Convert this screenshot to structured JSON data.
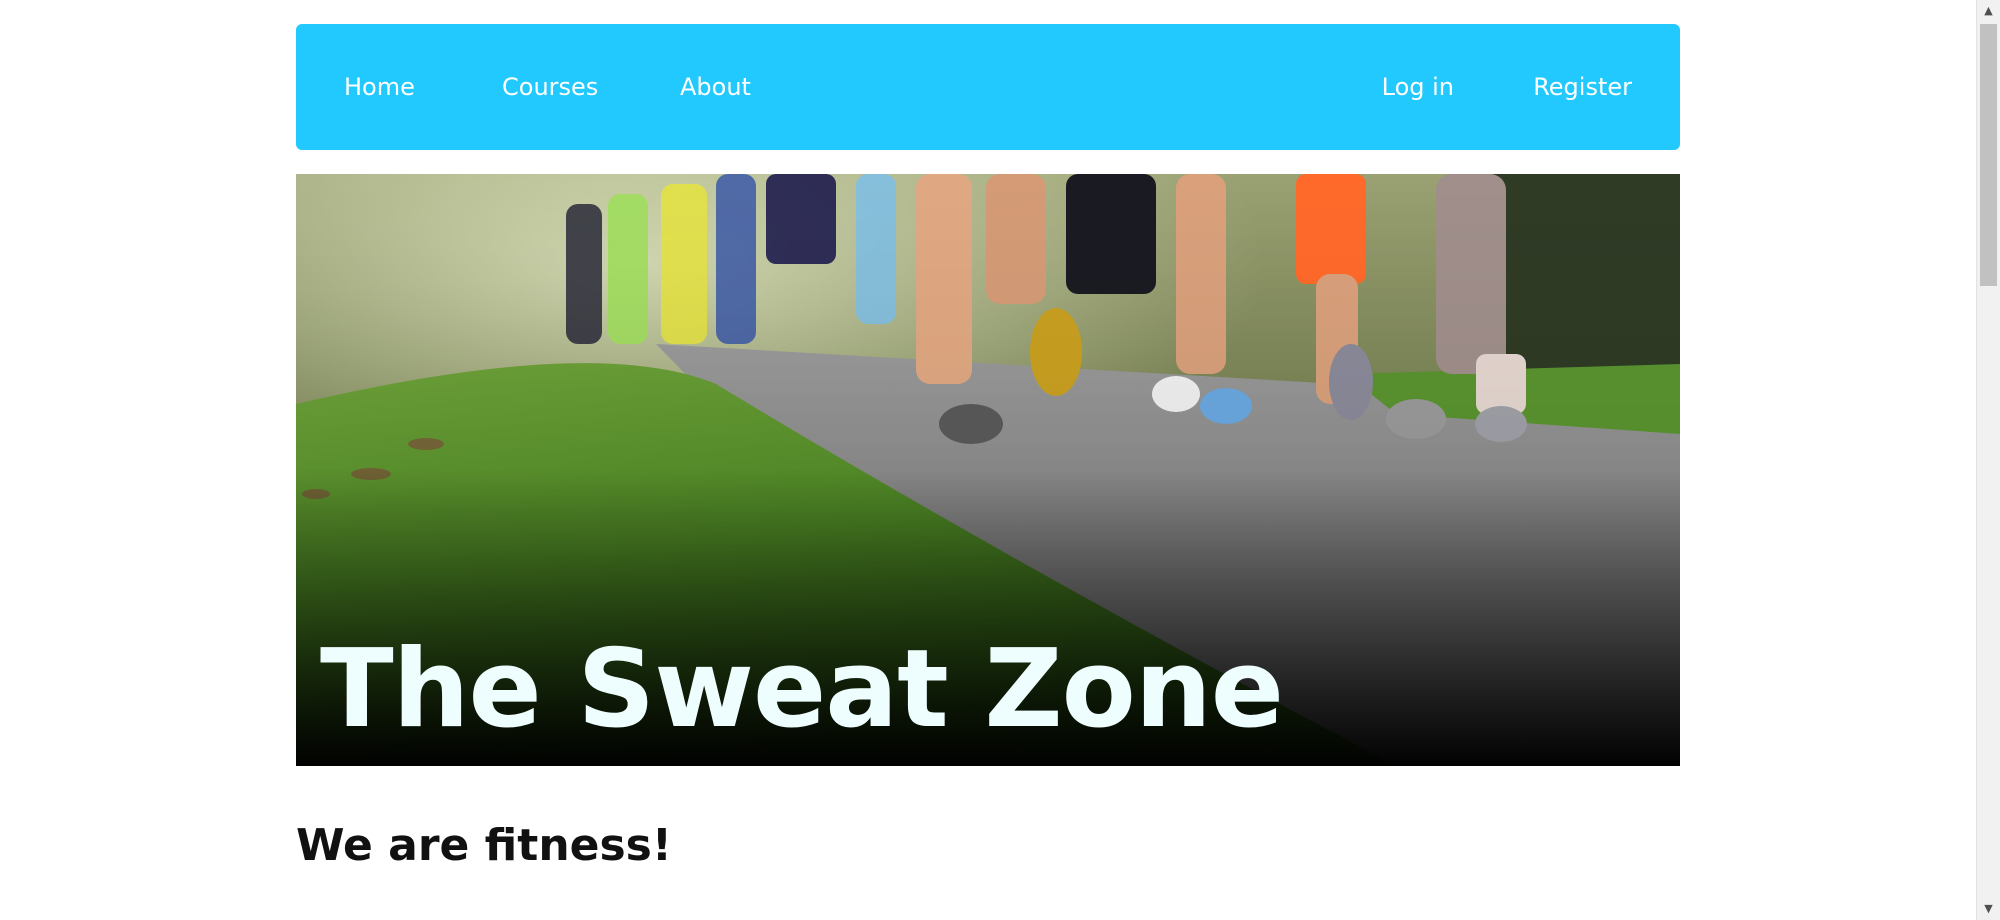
{
  "nav": {
    "home_label": "Home",
    "courses_label": "Courses",
    "about_label": "About",
    "login_label": "Log in",
    "register_label": "Register"
  },
  "hero": {
    "title": "The Sweat Zone",
    "image_subject": "marathon runners on a park path"
  },
  "main": {
    "heading": "We are fitness!"
  },
  "scrollbar": {
    "up_icon": "scroll-up-arrow-icon",
    "down_icon": "scroll-down-arrow-icon"
  },
  "colors": {
    "nav_background": "#22c9ff",
    "nav_text": "#ffffff",
    "hero_title": "#eefdfd",
    "heading_text": "#111111"
  }
}
